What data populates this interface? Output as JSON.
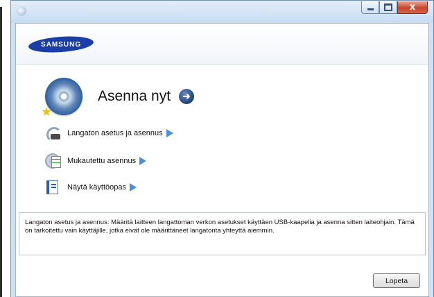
{
  "window": {
    "brand_logo_text": "SAMSUNG",
    "controls": {
      "minimize": "minimize",
      "maximize": "maximize",
      "close": "x"
    },
    "accent_color": "#1a3ea5"
  },
  "main": {
    "install_now_label": "Asenna nyt",
    "options": [
      {
        "label": "Langaton asetus ja asennus",
        "icon": "wireless-icon"
      },
      {
        "label": "Mukautettu asennus",
        "icon": "custom-install-icon"
      },
      {
        "label": "Näytä käyttöopas",
        "icon": "user-guide-icon"
      }
    ],
    "description": "Langaton asetus ja asennus: Määritä laitteen langattoman verkon asetukset käyttäen USB-kaapelia ja asenna sitten laiteohjain. Tämä on tarkoitettu vain käyttäjille, jotka eivät ole määrittäneet langatonta yhteyttä aiemmin."
  },
  "footer": {
    "quit_label": "Lopeta"
  }
}
